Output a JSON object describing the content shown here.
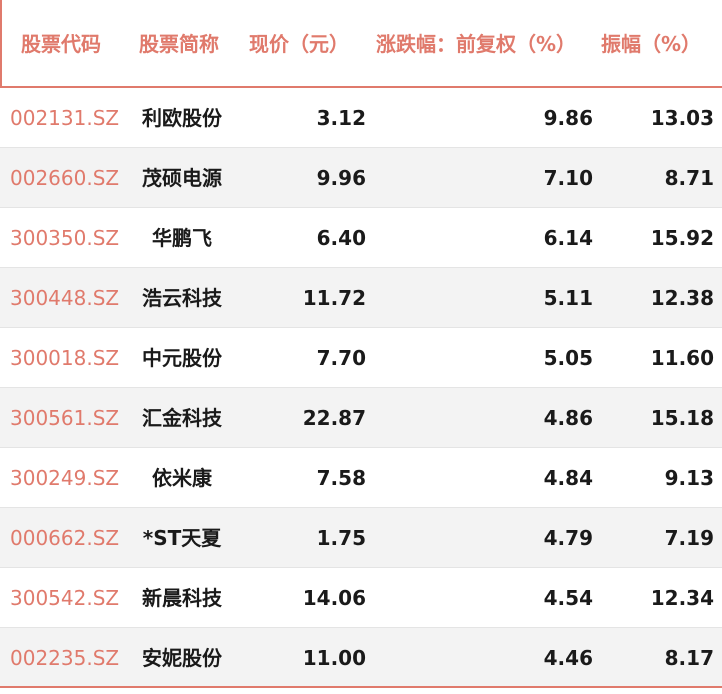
{
  "headers": {
    "code": "股票代码",
    "name": "股票简称",
    "price": "现价（元）",
    "change": "涨跌幅：前复权（%）",
    "amplitude": "振幅（%）"
  },
  "rows": [
    {
      "code": "002131.SZ",
      "name": "利欧股份",
      "price": "3.12",
      "change": "9.86",
      "amplitude": "13.03"
    },
    {
      "code": "002660.SZ",
      "name": "茂硕电源",
      "price": "9.96",
      "change": "7.10",
      "amplitude": "8.71"
    },
    {
      "code": "300350.SZ",
      "name": "华鹏飞",
      "price": "6.40",
      "change": "6.14",
      "amplitude": "15.92"
    },
    {
      "code": "300448.SZ",
      "name": "浩云科技",
      "price": "11.72",
      "change": "5.11",
      "amplitude": "12.38"
    },
    {
      "code": "300018.SZ",
      "name": "中元股份",
      "price": "7.70",
      "change": "5.05",
      "amplitude": "11.60"
    },
    {
      "code": "300561.SZ",
      "name": "汇金科技",
      "price": "22.87",
      "change": "4.86",
      "amplitude": "15.18"
    },
    {
      "code": "300249.SZ",
      "name": "依米康",
      "price": "7.58",
      "change": "4.84",
      "amplitude": "9.13"
    },
    {
      "code": "000662.SZ",
      "name": "*ST天夏",
      "price": "1.75",
      "change": "4.79",
      "amplitude": "7.19"
    },
    {
      "code": "300542.SZ",
      "name": "新晨科技",
      "price": "14.06",
      "change": "4.54",
      "amplitude": "12.34"
    },
    {
      "code": "002235.SZ",
      "name": "安妮股份",
      "price": "11.00",
      "change": "4.46",
      "amplitude": "8.17"
    }
  ],
  "colors": {
    "accent": "#e07a6c",
    "alt_row": "#f3f3f3",
    "text": "#1a1a1a"
  }
}
